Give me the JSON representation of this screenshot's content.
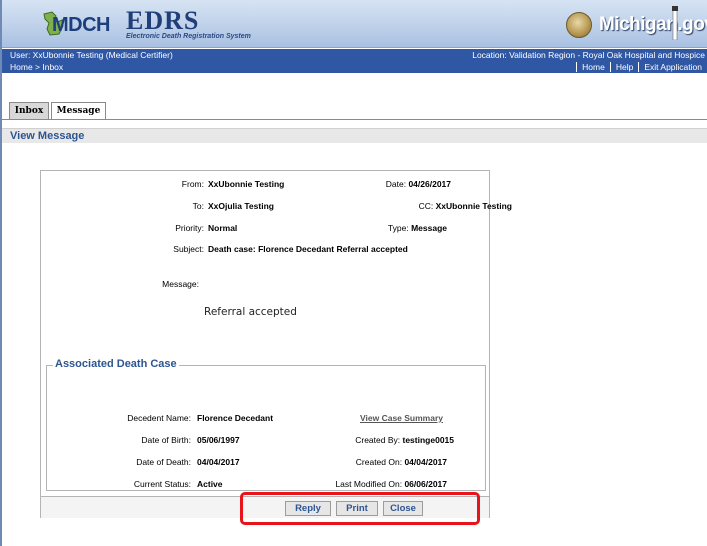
{
  "banner": {
    "agency_logo_text": "MDCH",
    "system_name": "EDRS",
    "system_subtitle": "Electronic Death Registration System",
    "state_site": "Michigan.gov"
  },
  "header": {
    "user": "User: XxUbonnie Testing (Medical Certifier)",
    "location": "Location: Validation Region - Royal Oak Hospital and Hospice",
    "breadcrumb": "Home > Inbox",
    "links": [
      "Home",
      "Help",
      "Exit Application"
    ]
  },
  "tabs": [
    {
      "label": "Inbox",
      "active": false
    },
    {
      "label": "Message",
      "active": true
    }
  ],
  "section_title": "View Message",
  "message": {
    "from_label": "From:",
    "from_value": "XxUbonnie Testing",
    "to_label": "To:",
    "to_value": "XxOjulia Testing",
    "priority_label": "Priority:",
    "priority_value": "Normal",
    "subject_label": "Subject:",
    "subject_value": "Death case: Florence Decedant Referral accepted",
    "date_label": "Date:",
    "date_value": "04/26/2017",
    "cc_label": "CC:",
    "cc_value": "XxUbonnie Testing",
    "type_label": "Type:",
    "type_value": "Message",
    "message_label": "Message:",
    "message_body": "Referral accepted"
  },
  "case": {
    "legend": "Associated Death Case",
    "decedent_label": "Decedent Name:",
    "decedent_value": "Florence Decedant",
    "dob_label": "Date of Birth:",
    "dob_value": "05/06/1997",
    "dod_label": "Date of Death:",
    "dod_value": "04/04/2017",
    "status_label": "Current Status:",
    "status_value": "Active",
    "summary_link": "View Case Summary",
    "created_by_label": "Created By:",
    "created_by_value": "testinge0015",
    "created_on_label": "Created On:",
    "created_on_value": "04/04/2017",
    "modified_label": "Last Modified On:",
    "modified_value": "06/06/2017"
  },
  "buttons": {
    "reply": "Reply",
    "print": "Print",
    "close": "Close"
  },
  "colors": {
    "header_blue": "#2f57a4",
    "title_blue": "#2d5592",
    "highlight_red": "#e8141c"
  }
}
